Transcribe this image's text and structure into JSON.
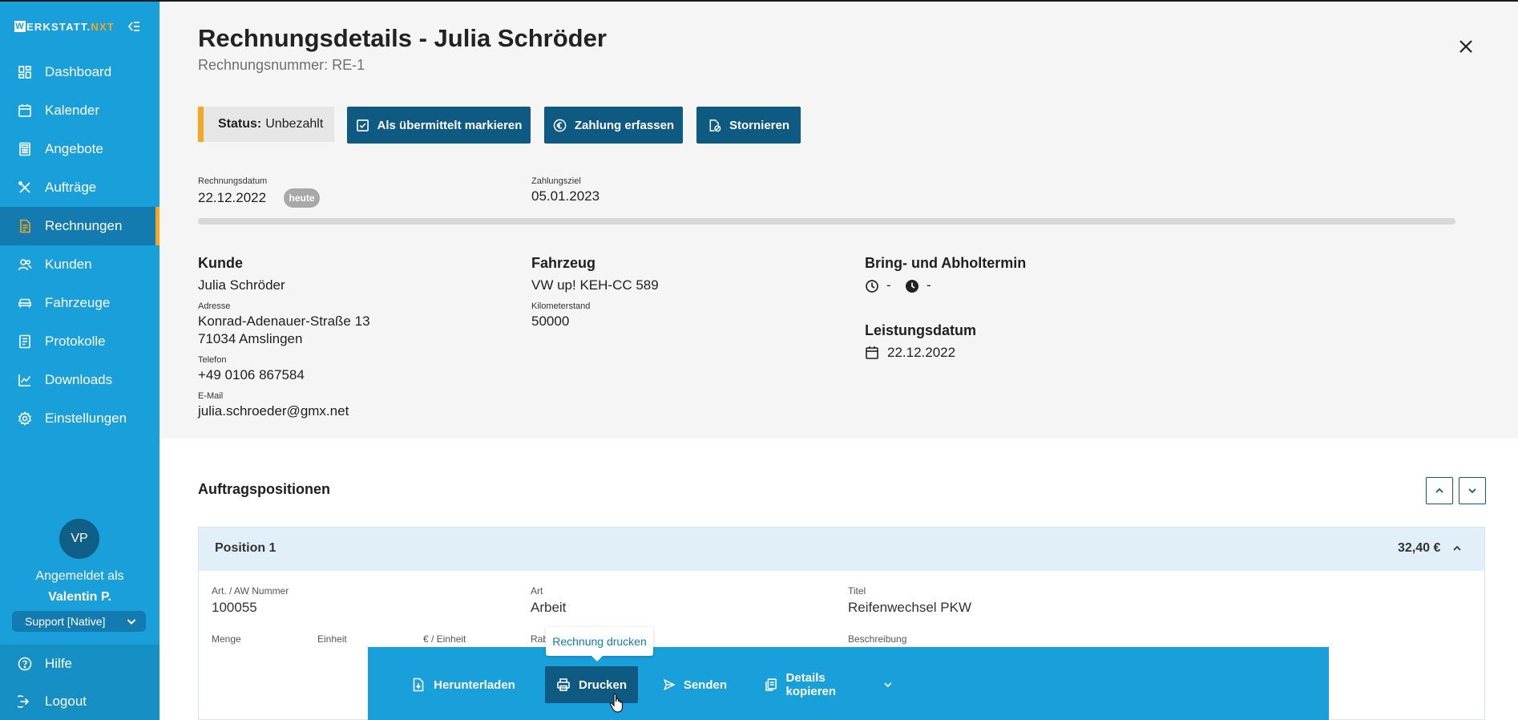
{
  "app": {
    "logo_w": "W",
    "logo_main": "ERKSTATT.",
    "logo_accent": "NXT",
    "accent_color": "#f5a623",
    "sidebar_color": "#199fd9",
    "dark_button_color": "#0e5a82"
  },
  "sidebar": {
    "items": [
      {
        "label": "Dashboard",
        "icon": "dashboard-icon"
      },
      {
        "label": "Kalender",
        "icon": "calendar-icon"
      },
      {
        "label": "Angebote",
        "icon": "calculator-icon"
      },
      {
        "label": "Aufträge",
        "icon": "tools-icon"
      },
      {
        "label": "Rechnungen",
        "icon": "invoice-icon",
        "active": true
      },
      {
        "label": "Kunden",
        "icon": "users-icon"
      },
      {
        "label": "Fahrzeuge",
        "icon": "car-icon"
      },
      {
        "label": "Protokolle",
        "icon": "protocol-icon"
      },
      {
        "label": "Downloads",
        "icon": "chart-line-icon"
      },
      {
        "label": "Einstellungen",
        "icon": "gear-icon"
      }
    ],
    "user": {
      "initials": "VP",
      "logged_in_label": "Angemeldet als",
      "name": "Valentin P.",
      "role": "Support [Native]"
    },
    "bottom": [
      {
        "label": "Hilfe",
        "icon": "help-icon"
      },
      {
        "label": "Logout",
        "icon": "logout-icon"
      }
    ]
  },
  "header": {
    "title": "Rechnungsdetails - Julia Schröder",
    "invoice_number": "Rechnungsnummer: RE-1"
  },
  "status": {
    "label": "Status:",
    "value": "Unbezahlt"
  },
  "actions": {
    "mark_sent": "Als übermittelt markieren",
    "record_payment": "Zahlung erfassen",
    "cancel": "Stornieren"
  },
  "dates": {
    "invoice_date_label": "Rechnungsdatum",
    "invoice_date": "22.12.2022",
    "today_badge": "heute",
    "due_label": "Zahlungsziel",
    "due_date": "05.01.2023"
  },
  "customer": {
    "heading": "Kunde",
    "name": "Julia Schröder",
    "address_label": "Adresse",
    "street": "Konrad-Adenauer-Straße 13",
    "city": "71034 Amslingen",
    "phone_label": "Telefon",
    "phone": "+49 0106 867584",
    "email_label": "E-Mail",
    "email": "julia.schroeder@gmx.net"
  },
  "vehicle": {
    "heading": "Fahrzeug",
    "name": "VW up! KEH-CC 589",
    "mileage_label": "Kilometerstand",
    "mileage": "50000"
  },
  "appointment": {
    "heading": "Bring- und Abholtermin",
    "bring_value": "-",
    "pickup_value": "-",
    "service_date_heading": "Leistungsdatum",
    "service_date": "22.12.2022"
  },
  "positions": {
    "heading": "Auftragspositionen",
    "items": [
      {
        "name": "Position 1",
        "price": "32,40 €",
        "art_no_label": "Art. / AW Nummer",
        "art_no": "100055",
        "type_label": "Art",
        "type": "Arbeit",
        "title_label": "Titel",
        "title": "Reifenwechsel PKW",
        "qty_label": "Menge",
        "unit_label": "Einheit",
        "unit_price_label": "€ / Einheit",
        "discount_label": "Rab",
        "description_label": "Beschreibung"
      }
    ]
  },
  "bottom_bar": {
    "download": "Herunterladen",
    "print": "Drucken",
    "send": "Senden",
    "copy_details": "Details kopieren",
    "print_tooltip": "Rechnung drucken"
  }
}
